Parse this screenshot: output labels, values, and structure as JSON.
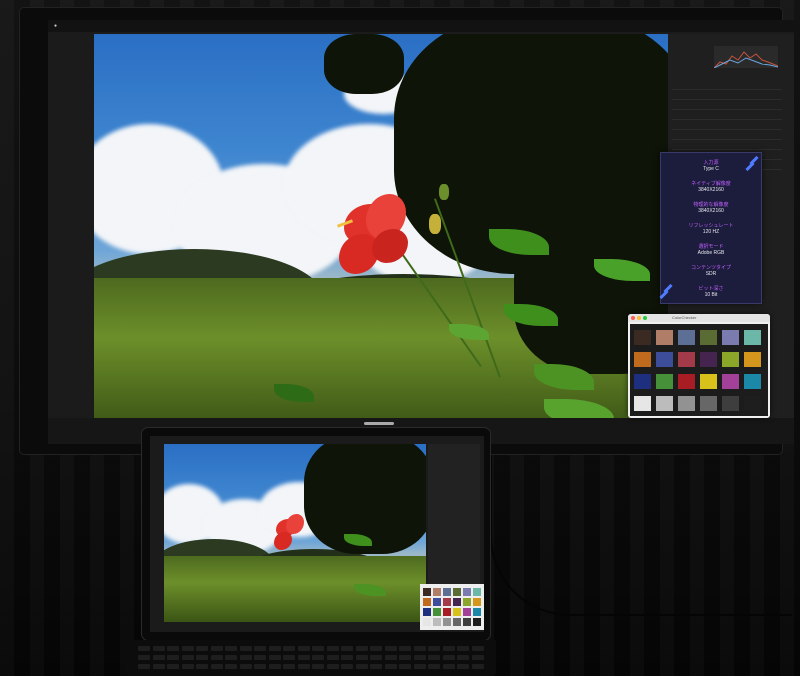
{
  "external_monitor": {
    "info_overlay": {
      "input_source": {
        "label": "入力源",
        "value": "Type C"
      },
      "native_resolution": {
        "label": "ネイティブ解像度",
        "value": "3840X2160"
      },
      "actual_resolution": {
        "label": "物理的な解像度",
        "value": "3840X2160"
      },
      "refresh_rate": {
        "label": "リフレッシュレート",
        "value": "120 HZ"
      },
      "preset_mode": {
        "label": "選択モード",
        "value": "Adobe RGB"
      },
      "content_type": {
        "label": "コンテンツタイプ",
        "value": "SDR"
      },
      "bit_depth": {
        "label": "ビット深さ",
        "value": "10 Bit"
      }
    },
    "color_checker_window": {
      "title": "ColorChecker"
    },
    "colors": {
      "accent_purple": "#c060ff",
      "overlay_bg": "#1c1c3c"
    }
  },
  "color_checker_swatches": [
    "#3b2a22",
    "#b07d68",
    "#5d6f95",
    "#5a6b33",
    "#7a7cb0",
    "#6cb8a8",
    "#c06a1d",
    "#3d4d9a",
    "#a23a4a",
    "#45254f",
    "#8ca62a",
    "#d4961d",
    "#1f2f80",
    "#46903a",
    "#a81c24",
    "#d8c11a",
    "#a34098",
    "#1b88a8",
    "#e6e6e6",
    "#bcbcbc",
    "#929292",
    "#676767",
    "#3e3e3e",
    "#1e1e1e"
  ]
}
